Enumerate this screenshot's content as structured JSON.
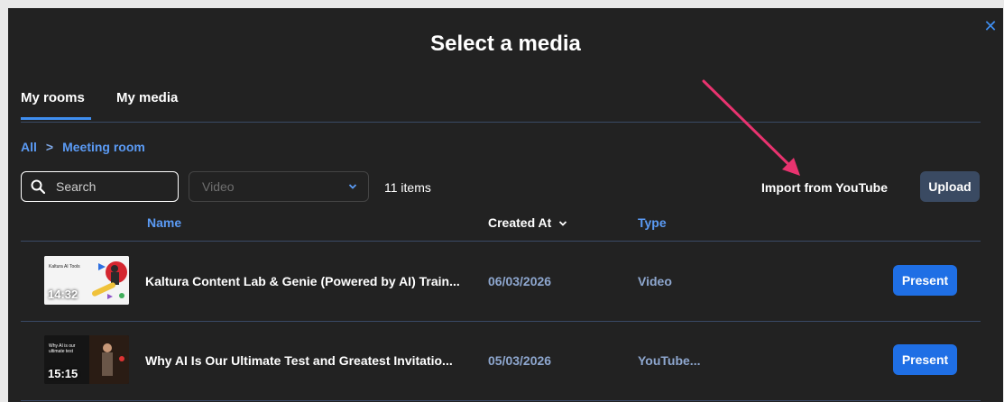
{
  "modal": {
    "title": "Select a media",
    "close_icon": "close-icon"
  },
  "tabs": [
    {
      "label": "My rooms",
      "active": true
    },
    {
      "label": "My media",
      "active": false
    }
  ],
  "breadcrumb": {
    "root": "All",
    "separator": ">",
    "current": "Meeting room"
  },
  "toolbar": {
    "search_placeholder": "Search",
    "filter_value": "Video",
    "item_count": "11 items",
    "import_label": "Import from YouTube",
    "upload_label": "Upload"
  },
  "table": {
    "headers": {
      "name": "Name",
      "created": "Created At",
      "type": "Type"
    },
    "rows": [
      {
        "thumb_caption": "Kaltura AI Tools",
        "duration": "14:32",
        "name": "Kaltura Content Lab & Genie (Powered by AI) Train...",
        "created": "06/03/2026",
        "type": "Video",
        "action": "Present"
      },
      {
        "thumb_caption": "Why AI is our ultimate test",
        "duration": "15:15",
        "name": "Why AI Is Our Ultimate Test and Greatest Invitatio...",
        "created": "05/03/2026",
        "type": "YouTube...",
        "action": "Present"
      }
    ]
  },
  "colors": {
    "accent": "#3f8ef0",
    "annotation_arrow": "#e8336f",
    "background": "#222222"
  }
}
